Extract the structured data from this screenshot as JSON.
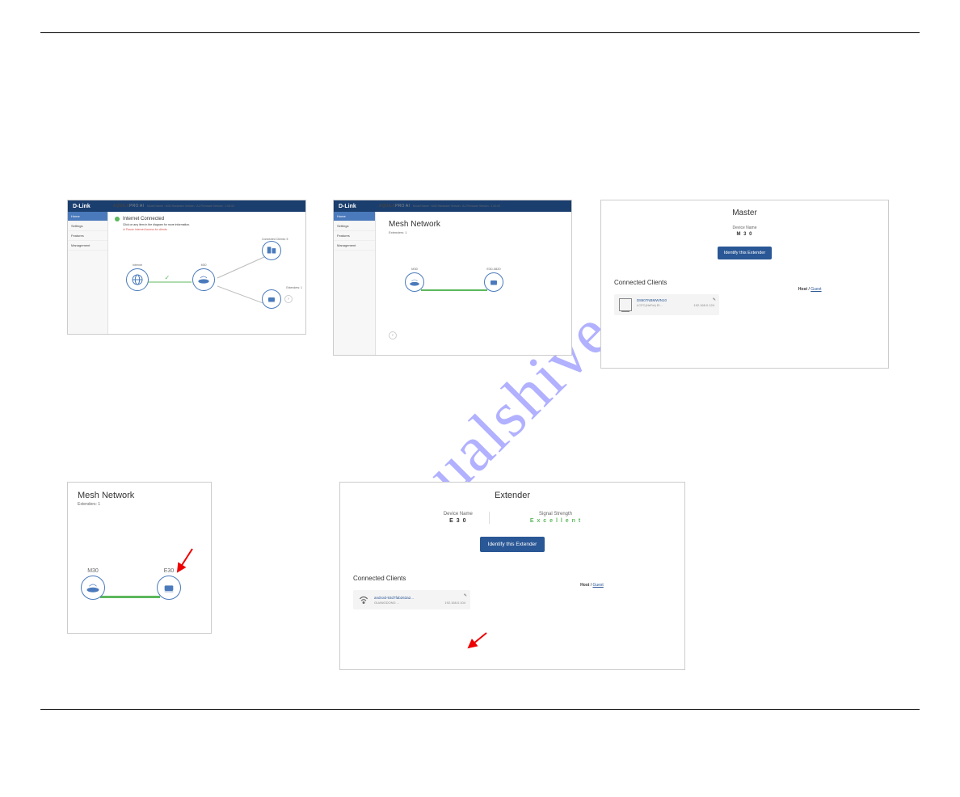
{
  "watermark": "manualshive.com",
  "header": {
    "brand_logo": "D-Link",
    "product_line_html": "AQUILAPRO AI",
    "product_line_1": "AQUILA",
    "product_line_2": "PRO AI",
    "model_info": "Model Name : M30 Hardware Version : A1 Firmware Version : 1.00.02"
  },
  "nav": {
    "home": "Home",
    "settings": "Settings",
    "features": "Features",
    "management": "Management"
  },
  "panel1": {
    "status": "Internet Connected",
    "subtext": "Click on any item in the diagram for more information.",
    "warning": "⊘ Pause Internet Access for clients",
    "node_internet": "Internet",
    "node_router": "M30",
    "clients_label": "Connected Clients: 5",
    "extenders_label": "Extenders: 1"
  },
  "panel2": {
    "title": "Mesh Network",
    "subtitle": "Extenders: 1",
    "node_m30": "M30",
    "node_e30": "E30-0820"
  },
  "panel3": {
    "title": "Master",
    "device_name_label": "Device Name",
    "device_name": "M 3 0",
    "identify_btn": "Identify this Extender",
    "connected_clients": "Connected Clients",
    "host": "Host",
    "guest": "Guest",
    "client_name": "D8607NBMWIN10",
    "client_vendor": "LCFC(HeFei) El...",
    "client_ip": "192.168.0.124"
  },
  "panel4": {
    "title": "Mesh Network",
    "subtitle": "Extenders: 1",
    "node_m30": "M30",
    "node_e30": "E30"
  },
  "panel5": {
    "title": "Extender",
    "device_name_label": "Device Name",
    "device_name": "E 3 0",
    "signal_label": "Signal Strength",
    "signal_value": "E x c e l l e n t",
    "identify_btn": "Identify this Extender",
    "connected_clients": "Connected Clients",
    "host": "Host",
    "guest": "Guest",
    "client_name": "android-93d7fab263a2...",
    "client_vendor": "GUANGDONG ...",
    "client_ip": "192.168.0.104"
  }
}
